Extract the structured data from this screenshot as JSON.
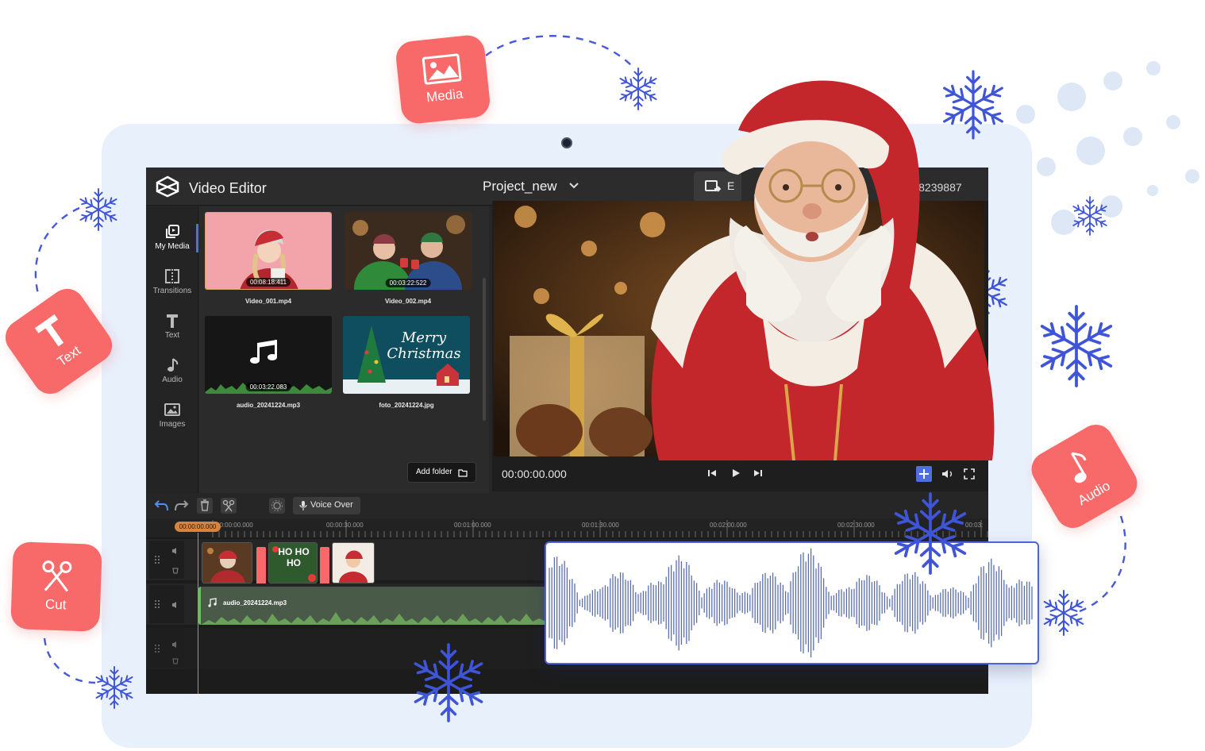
{
  "app": {
    "title": "Video Editor",
    "project_name": "Project_new",
    "export_label": "E",
    "user_id": "86658239887"
  },
  "badges": {
    "media": "Media",
    "text": "Text",
    "cut": "Cut",
    "audio": "Audio"
  },
  "sidebar": {
    "items": [
      {
        "label": "My Media",
        "icon": "my-media-icon",
        "active": true
      },
      {
        "label": "Transitions",
        "icon": "transitions-icon",
        "active": false
      },
      {
        "label": "Text",
        "icon": "text-icon",
        "active": false
      },
      {
        "label": "Audio",
        "icon": "audio-icon",
        "active": false
      },
      {
        "label": "Images",
        "icon": "images-icon",
        "active": false
      }
    ]
  },
  "media": {
    "items": [
      {
        "name": "Video_001.mp4",
        "duration": "00:08:18:411"
      },
      {
        "name": "Video_002.mp4",
        "duration": "00:03:22:522"
      },
      {
        "name": "audio_20241224.mp3",
        "duration": "00:03:22.083"
      },
      {
        "name": "foto_20241224.jpg",
        "duration": ""
      }
    ],
    "card_text": "Merry Christmas",
    "add_folder_label": "Add folder"
  },
  "preview": {
    "timecode": "00:00:00.000"
  },
  "timeline": {
    "voice_over_label": "Voice Over",
    "playhead_time": "00:00:00.000",
    "ruler_labels": [
      "00:00:00.000",
      "00:00:30.000",
      "00:01:00.000",
      "00:01:30.000",
      "00:02:00.000",
      "00:02:30.000",
      "00:03:"
    ],
    "audio_clip_name": "audio_20241224.mp3",
    "clip_text": "HO HO HO"
  },
  "colors": {
    "accent_blue": "#4f6fe0",
    "badge_coral": "#f86a6a",
    "playhead_orange": "#d8843f",
    "snowflake_blue": "#3f55d8",
    "audio_green": "#6fbe5e"
  }
}
